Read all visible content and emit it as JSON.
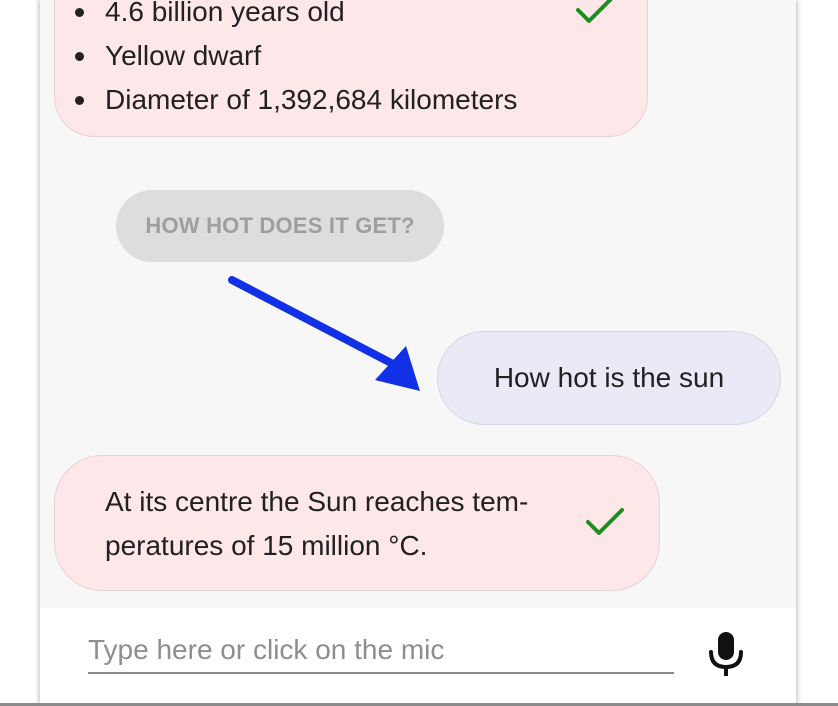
{
  "messages": {
    "bot_facts": {
      "items": [
        "4.6 billion years old",
        "Yellow dwarf",
        "Diameter of 1,392,684 kilometers"
      ]
    },
    "suggestion_chip": "HOW HOT DOES IT GET?",
    "user_message": "How hot is the sun",
    "bot_answer": "At its centre the Sun reaches tem-peratures of 15 million °C."
  },
  "input": {
    "placeholder": "Type here or click on the mic",
    "value": ""
  },
  "icons": {
    "check": "check-icon",
    "mic": "mic-icon",
    "arrow": "arrow-annotation"
  },
  "colors": {
    "bot_bubble": "#fde7e9",
    "user_bubble": "#e9eaf5",
    "chip": "#dddddd",
    "check": "#1e8e1e",
    "arrow": "#1230e6",
    "background": "#f7f7f7"
  }
}
